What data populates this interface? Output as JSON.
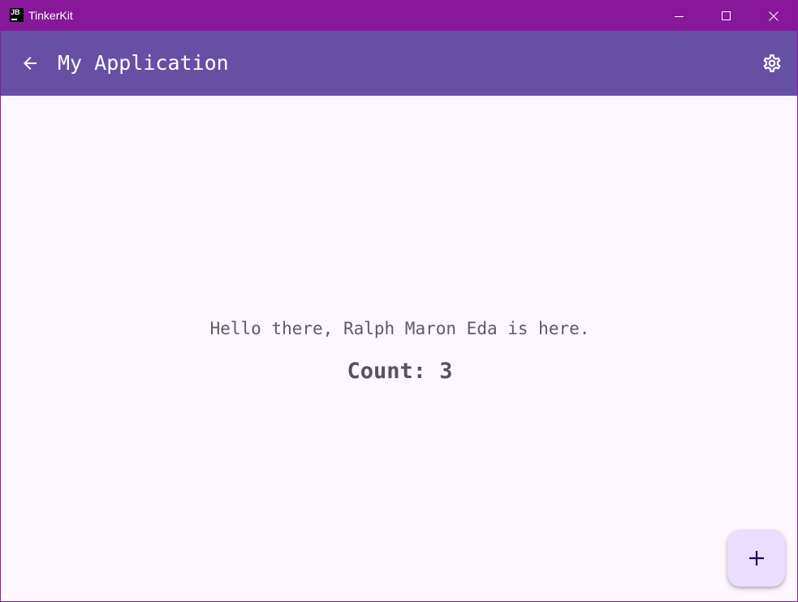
{
  "window": {
    "title": "TinkerKit",
    "icon_text": "JB",
    "controls": {
      "minimize": "minimize-icon",
      "maximize": "maximize-icon",
      "close": "close-icon"
    },
    "frame_color": "#861899"
  },
  "app_bar": {
    "title": "My Application",
    "back_icon": "arrow-back-icon",
    "settings_icon": "gear-icon",
    "background": "#6750a4"
  },
  "main": {
    "greeting": "Hello there, Ralph Maron Eda is here.",
    "count_text": "Count: 3",
    "background": "#fdf7ff"
  },
  "fab": {
    "icon": "plus-icon",
    "background": "#eaddff"
  }
}
